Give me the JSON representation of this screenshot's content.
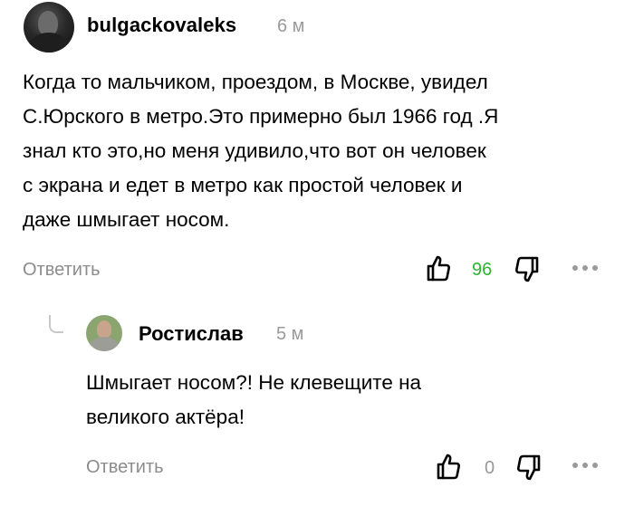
{
  "comments": [
    {
      "author": "bulgackovaleks",
      "time": "6 м",
      "avatar_icon": "user-avatar-photo",
      "text_lines": [
        "Когда то мальчиком, проездом, в Москве, увидел",
        "С.Юрского в метро.Это примерно был 1966 год .Я",
        "знал кто это,но меня удивило,что вот он человек",
        "с экрана и едет в метро как простой человек и",
        "даже шмыгает носом."
      ],
      "reply_label": "Ответить",
      "likes": "96",
      "likes_color": "#2cb52f"
    },
    {
      "author": "Ростислав",
      "time": "5 м",
      "avatar_icon": "user-avatar-photo",
      "text_lines": [
        "Шмыгает носом?! Не клевещите на",
        "великого актёра!"
      ],
      "reply_label": "Ответить",
      "likes": "0",
      "likes_color": "#9a9a9a"
    }
  ],
  "icons": {
    "like": "thumbs-up-icon",
    "dislike": "thumbs-down-icon",
    "more": "more-horizontal-icon",
    "thread": "reply-thread-line"
  }
}
